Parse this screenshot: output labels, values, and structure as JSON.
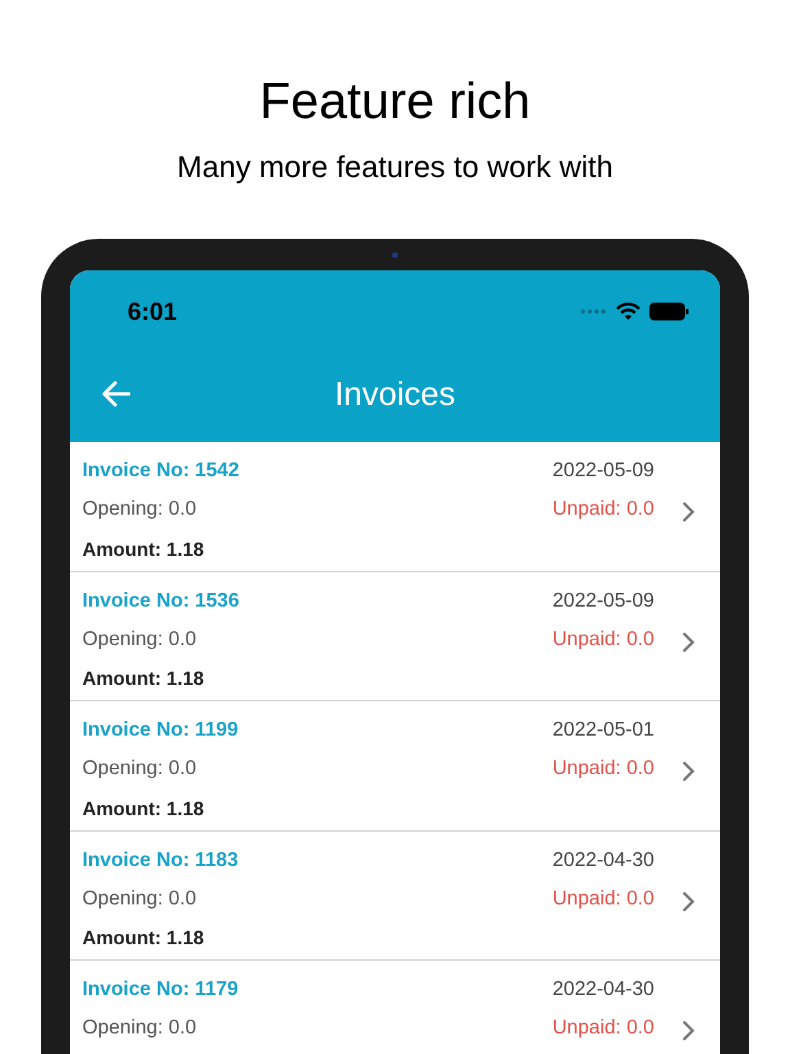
{
  "headline": "Feature rich",
  "subheadline": "Many more features to work with",
  "status_bar": {
    "time": "6:01"
  },
  "app_bar": {
    "title": "Invoices"
  },
  "invoices": [
    {
      "number": "Invoice No: 1542",
      "date": "2022-05-09",
      "opening": "Opening: 0.0",
      "unpaid": "Unpaid: 0.0",
      "amount": "Amount: 1.18"
    },
    {
      "number": "Invoice No: 1536",
      "date": "2022-05-09",
      "opening": "Opening: 0.0",
      "unpaid": "Unpaid: 0.0",
      "amount": "Amount: 1.18"
    },
    {
      "number": "Invoice No: 1199",
      "date": "2022-05-01",
      "opening": "Opening: 0.0",
      "unpaid": "Unpaid: 0.0",
      "amount": "Amount: 1.18"
    },
    {
      "number": "Invoice No: 1183",
      "date": "2022-04-30",
      "opening": "Opening: 0.0",
      "unpaid": "Unpaid: 0.0",
      "amount": "Amount: 1.18"
    },
    {
      "number": "Invoice No: 1179",
      "date": "2022-04-30",
      "opening": "Opening: 0.0",
      "unpaid": "Unpaid: 0.0"
    }
  ]
}
